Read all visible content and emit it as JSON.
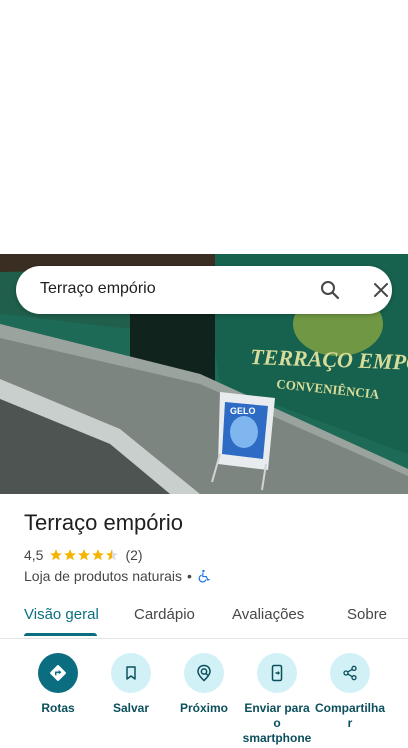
{
  "search": {
    "query": "Terraço empório"
  },
  "place": {
    "name": "Terraço empório",
    "rating": "4,5",
    "review_count": "(2)",
    "category": "Loja de produtos naturais",
    "separator": "•"
  },
  "photo": {
    "sign_line1": "TERRAÇO EMPÓRIO",
    "sign_line2": "CONVENIÊNCIA",
    "board_text": "GELO"
  },
  "tabs": [
    {
      "label": "Visão geral",
      "active": true
    },
    {
      "label": "Cardápio"
    },
    {
      "label": "Avaliações"
    },
    {
      "label": "Sobre"
    }
  ],
  "actions": [
    {
      "label": "Rotas",
      "icon": "directions-icon"
    },
    {
      "label": "Salvar",
      "icon": "bookmark-icon"
    },
    {
      "label": "Próximo",
      "icon": "nearby-icon"
    },
    {
      "label_line1": "Enviar para",
      "label_line2": "o",
      "label_line3": "smartphone",
      "icon": "send-to-phone-icon"
    },
    {
      "label_line1": "Compartilha",
      "label_line2": "r",
      "icon": "share-icon"
    }
  ],
  "colors": {
    "accent": "#0b6e80",
    "action_bg": "#d2f1f7",
    "star": "#f4b400"
  }
}
